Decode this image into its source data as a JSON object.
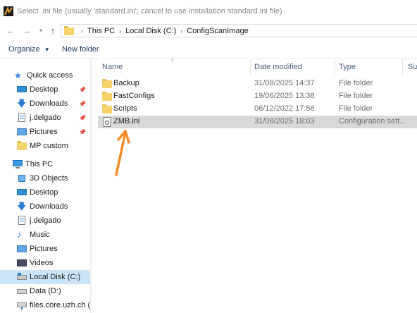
{
  "window": {
    "title": "Select .ini file (usually 'standard.ini'; cancel to use installation standard.ini file)"
  },
  "breadcrumbs": [
    "This PC",
    "Local Disk (C:)",
    "ConfigScanImage"
  ],
  "toolbar": {
    "organize_label": "Organize",
    "new_folder_label": "New folder"
  },
  "columns": {
    "name": "Name",
    "date": "Date modified",
    "type": "Type",
    "size": "Siz"
  },
  "sidebar": {
    "items": [
      {
        "label": "Quick access",
        "icon": "star-icon"
      },
      {
        "label": "Desktop",
        "icon": "desktop-icon",
        "pinned": true
      },
      {
        "label": "Downloads",
        "icon": "download-icon",
        "pinned": true
      },
      {
        "label": "j.delgado",
        "icon": "document-icon",
        "pinned": true
      },
      {
        "label": "Pictures",
        "icon": "pictures-icon",
        "pinned": true
      },
      {
        "label": "MP custom",
        "icon": "folder-icon"
      },
      {
        "label": "This PC",
        "icon": "computer-icon"
      },
      {
        "label": "3D Objects",
        "icon": "cube-icon"
      },
      {
        "label": "Desktop",
        "icon": "desktop-icon"
      },
      {
        "label": "Downloads",
        "icon": "download-icon"
      },
      {
        "label": "j.delgado",
        "icon": "document-icon"
      },
      {
        "label": "Music",
        "icon": "music-icon"
      },
      {
        "label": "Pictures",
        "icon": "pictures-icon"
      },
      {
        "label": "Videos",
        "icon": "video-icon"
      },
      {
        "label": "Local Disk (C:)",
        "icon": "disk-icon",
        "selected": true
      },
      {
        "label": "Data (D:)",
        "icon": "drive-icon"
      },
      {
        "label": "files.core.uzh.ch (Z:",
        "icon": "network-drive-icon"
      }
    ]
  },
  "files": [
    {
      "name": "Backup",
      "date": "31/08/2025 14:37",
      "type": "File folder",
      "kind": "folder"
    },
    {
      "name": "FastConfigs",
      "date": "19/06/2025 13:38",
      "type": "File folder",
      "kind": "folder"
    },
    {
      "name": "Scripts",
      "date": "06/12/2022 17:56",
      "type": "File folder",
      "kind": "folder"
    },
    {
      "name": "ZMB.ini",
      "date": "31/08/2025 18:03",
      "type": "Configuration sett...",
      "kind": "ini",
      "selected": true
    }
  ],
  "colors": {
    "annotation_arrow": "#f28c28",
    "selection": "#cce4f7",
    "file_selection": "#d9d9d9",
    "folder": "#f6d36b"
  }
}
